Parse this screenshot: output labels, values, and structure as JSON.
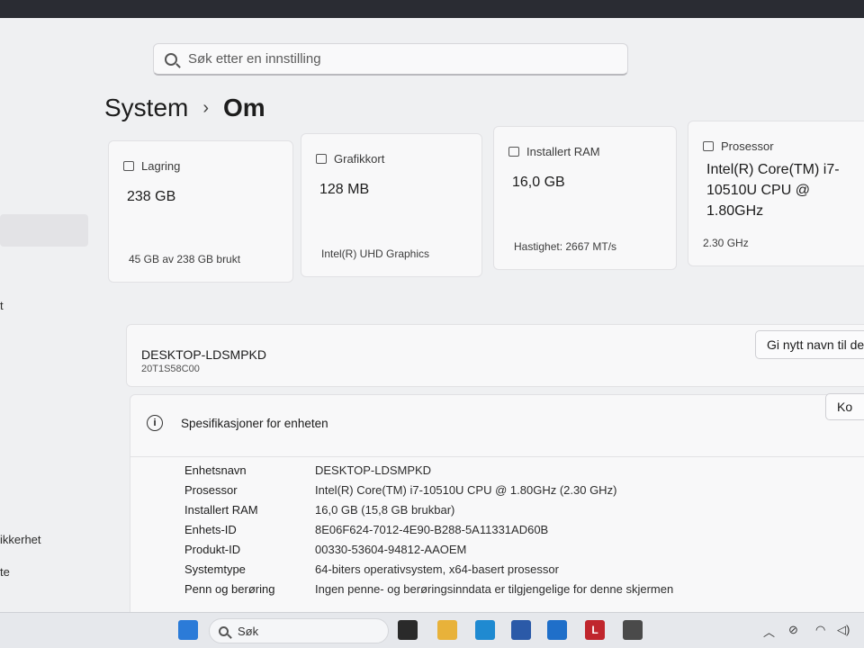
{
  "search": {
    "placeholder": "Søk etter en innstilling"
  },
  "breadcrumb": {
    "parent": "System",
    "separator": "›",
    "current": "Om"
  },
  "sidebar_fragments": [
    "t",
    "ikkerhet",
    "te"
  ],
  "cards": [
    {
      "icon": "storage-icon",
      "title": "Lagring",
      "value": "238 GB",
      "sub": "45 GB av 238 GB brukt"
    },
    {
      "icon": "graphics-card-icon",
      "title": "Grafikkort",
      "value": "128 MB",
      "sub": "Intel(R) UHD Graphics"
    },
    {
      "icon": "ram-icon",
      "title": "Installert RAM",
      "value": "16,0 GB",
      "sub": "Hastighet: 2667 MT/s"
    },
    {
      "icon": "processor-icon",
      "title": "Prosessor",
      "value": "Intel(R) Core(TM) i7-10510U CPU @ 1.80GHz",
      "sub": "2.30 GHz"
    }
  ],
  "device": {
    "name": "DESKTOP-LDSMPKD",
    "model": "20T1S58C00",
    "rename_button": "Gi nytt navn til de"
  },
  "specs": {
    "title": "Spesifikasjoner for enheten",
    "copy_button": "Ko",
    "rows": [
      {
        "label": "Enhetsnavn",
        "value": "DESKTOP-LDSMPKD"
      },
      {
        "label": "Prosessor",
        "value": "Intel(R) Core(TM) i7-10510U CPU @ 1.80GHz (2.30 GHz)"
      },
      {
        "label": "Installert RAM",
        "value": "16,0 GB (15,8 GB brukbar)"
      },
      {
        "label": "Enhets-ID",
        "value": "8E06F624-7012-4E90-B288-5A11331AD60B"
      },
      {
        "label": "Produkt-ID",
        "value": "00330-53604-94812-AAOEM"
      },
      {
        "label": "Systemtype",
        "value": "64-biters operativsystem, x64-basert prosessor"
      },
      {
        "label": "Penn og berøring",
        "value": "Ingen penne- og berøringsinndata er tilgjengelige for denne skjermen"
      }
    ]
  },
  "taskbar": {
    "search_label": "Søk",
    "apps": [
      {
        "name": "windows-start-icon",
        "color": "#2b7bd8"
      },
      {
        "name": "task-view-icon",
        "color": "#2a2a2a"
      },
      {
        "name": "file-explorer-icon",
        "color": "#e8b23a"
      },
      {
        "name": "edge-icon",
        "color": "#1f8ad1"
      },
      {
        "name": "microsoft-store-icon",
        "color": "#2b5aa8"
      },
      {
        "name": "outlook-icon",
        "color": "#1f6fc9"
      },
      {
        "name": "l-app-icon",
        "color": "#c0262d",
        "label": "L"
      },
      {
        "name": "settings-icon",
        "color": "#4a4a4a"
      }
    ]
  }
}
